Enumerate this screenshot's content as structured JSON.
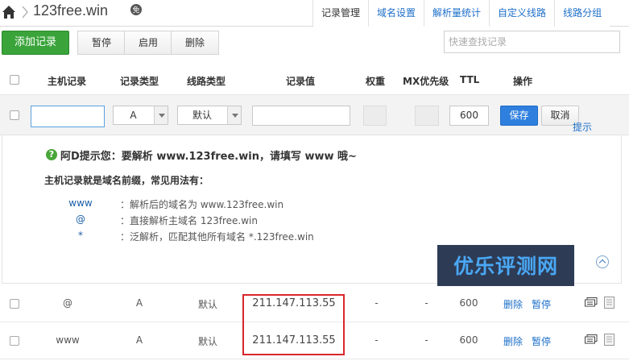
{
  "header": {
    "domain": "123free.win",
    "tabs": [
      "记录管理",
      "域名设置",
      "解析量统计",
      "自定义线路",
      "线路分组"
    ],
    "active_tab": 0
  },
  "toolbar": {
    "add_label": "添加记录",
    "pause_label": "暂停",
    "enable_label": "启用",
    "delete_label": "删除",
    "search_placeholder": "快速查找记录"
  },
  "columns": {
    "host": "主机记录",
    "type": "记录类型",
    "line": "线路类型",
    "value": "记录值",
    "weight": "权重",
    "mx": "MX优先级",
    "ttl": "TTL",
    "ops": "操作"
  },
  "edit_row": {
    "host_value": "",
    "type_value": "A",
    "line_value": "默认",
    "record_value": "",
    "ttl_value": "600",
    "save_label": "保存",
    "cancel_label": "取消"
  },
  "tip": {
    "title": "阿D提示您：要解析 www.123free.win，请填写 www 哦~",
    "subtitle": "主机记录就是域名前缀，常见用法有：",
    "examples": [
      {
        "key": "www",
        "desc": "：解析后的域名为 www.123free.win"
      },
      {
        "key": "@",
        "desc": "：直接解析主域名 123free.win"
      },
      {
        "key": "*",
        "desc": "：泛解析，匹配其他所有域名 *.123free.win"
      }
    ],
    "hide_label": "提示"
  },
  "watermark": "优乐评测网",
  "records": [
    {
      "host": "@",
      "type": "A",
      "line": "默认",
      "value": "211.147.113.55",
      "weight": "-",
      "mx": "-",
      "ttl": "600",
      "delete_label": "删除",
      "pause_label": "暂停"
    },
    {
      "host": "www",
      "type": "A",
      "line": "默认",
      "value": "211.147.113.55",
      "weight": "-",
      "mx": "-",
      "ttl": "600",
      "delete_label": "删除",
      "pause_label": "暂停"
    }
  ],
  "colors": {
    "add_button": "#3aa43a",
    "save_button": "#2f80de",
    "link": "#1d6fc9",
    "highlight": "#d9262c",
    "watermark_bg": "#2d3b55",
    "watermark_text": "#4aa8f5"
  }
}
